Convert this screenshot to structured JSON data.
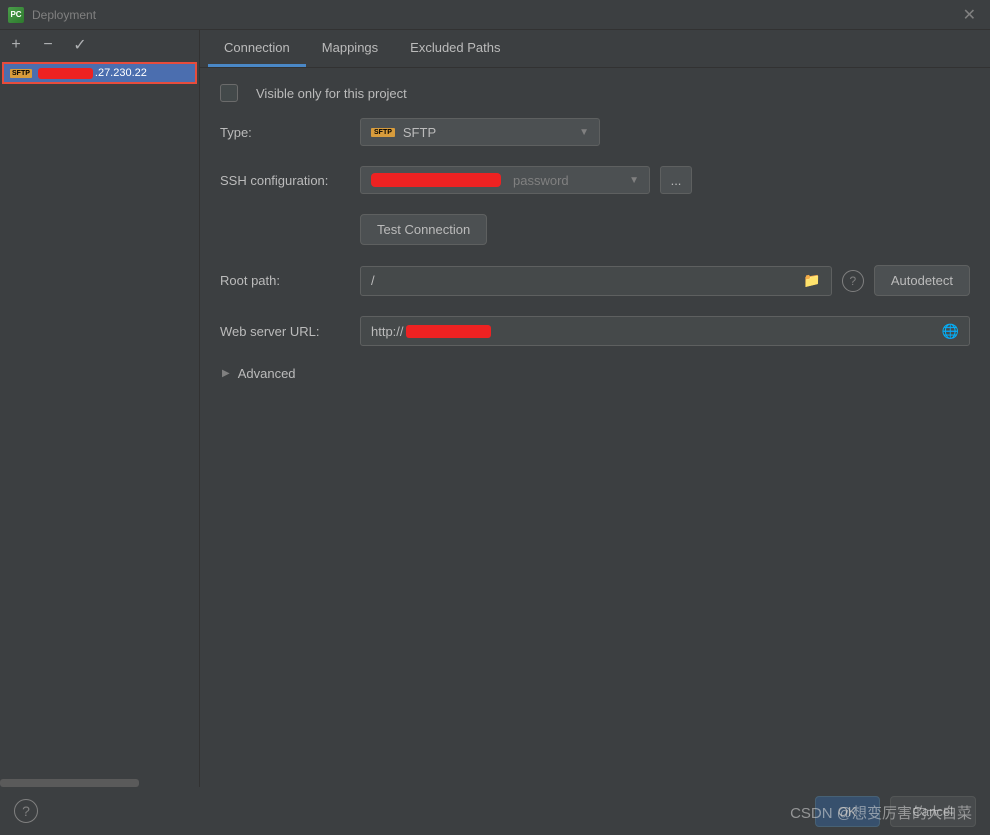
{
  "window": {
    "title": "Deployment",
    "icon_label": "PC"
  },
  "toolbar": {
    "add": "+",
    "remove": "−",
    "apply": "✓"
  },
  "sidebar": {
    "server_suffix": ".27.230.22",
    "sftp_badge": "SFTP"
  },
  "tabs": [
    {
      "label": "Connection",
      "active": true
    },
    {
      "label": "Mappings",
      "active": false
    },
    {
      "label": "Excluded Paths",
      "active": false
    }
  ],
  "form": {
    "visible_only_label": "Visible only for this project",
    "type_label": "Type:",
    "type_value": "SFTP",
    "type_icon": "SFTP",
    "ssh_label": "SSH configuration:",
    "ssh_password_hint": "password",
    "ellipsis": "...",
    "test_connection": "Test Connection",
    "root_path_label": "Root path:",
    "root_path_value": "/",
    "autodetect": "Autodetect",
    "web_url_label": "Web server URL:",
    "web_url_prefix": "http://",
    "advanced_label": "Advanced"
  },
  "footer": {
    "ok": "OK",
    "cancel": "Cancel"
  },
  "watermark": "CSDN @想变厉害的大白菜"
}
